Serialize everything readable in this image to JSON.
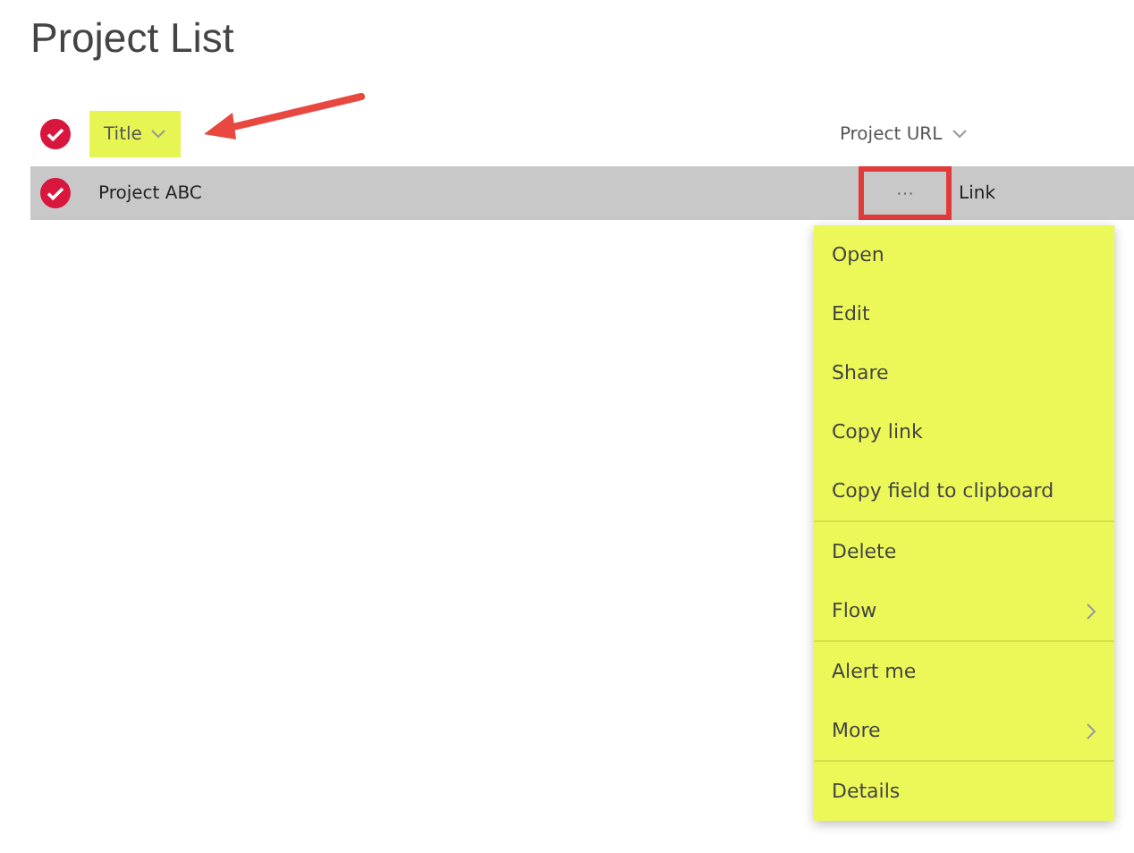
{
  "title": "Project List",
  "header": {
    "checked": true,
    "columns": [
      {
        "label": "Title",
        "highlighted": true
      },
      {
        "label": "Project URL",
        "highlighted": false
      }
    ]
  },
  "rows": [
    {
      "title": "Project ABC",
      "url": "Link",
      "selected": true,
      "more": "···",
      "more_highlighted": true
    }
  ],
  "menu": {
    "groups": [
      [
        {
          "label": "Open",
          "submenu": false
        },
        {
          "label": "Edit",
          "submenu": false
        },
        {
          "label": "Share",
          "submenu": false
        },
        {
          "label": "Copy link",
          "submenu": false
        },
        {
          "label": "Copy field to clipboard",
          "submenu": false
        }
      ],
      [
        {
          "label": "Delete",
          "submenu": false
        },
        {
          "label": "Flow",
          "submenu": true
        }
      ],
      [
        {
          "label": "Alert me",
          "submenu": false
        },
        {
          "label": "More",
          "submenu": true
        }
      ],
      [
        {
          "label": "Details",
          "submenu": false
        }
      ]
    ]
  }
}
